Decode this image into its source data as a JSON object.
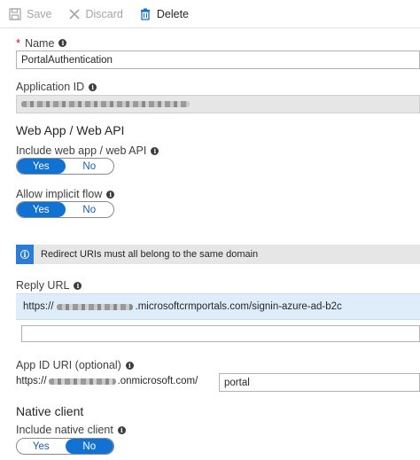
{
  "toolbar": {
    "save_label": "Save",
    "discard_label": "Discard",
    "delete_label": "Delete"
  },
  "name": {
    "required_marker": "*",
    "label": "Name",
    "value": "PortalAuthentication"
  },
  "application_id": {
    "label": "Application ID"
  },
  "web_app": {
    "heading": "Web App / Web API",
    "include_label": "Include web app / web API",
    "include_yes": "Yes",
    "include_no": "No",
    "include_selected": "Yes",
    "implicit_label": "Allow implicit flow",
    "implicit_yes": "Yes",
    "implicit_no": "No",
    "implicit_selected": "Yes"
  },
  "banner": {
    "icon": "info-icon",
    "text": "Redirect URIs must all belong to the same domain"
  },
  "reply_url": {
    "label": "Reply URL",
    "prefix": "https://",
    "suffix": ".microsoftcrmportals.com/signin-azure-ad-b2c",
    "new_value": ""
  },
  "app_id_uri": {
    "label": "App ID URI (optional)",
    "prefix": "https://",
    "domain_suffix": ".onmicrosoft.com/",
    "value": "portal"
  },
  "native": {
    "heading": "Native client",
    "include_label": "Include native client",
    "yes": "Yes",
    "no": "No",
    "selected": "No"
  },
  "colors": {
    "accent": "#1272d3",
    "required": "#e00b1c",
    "banner_bg": "#e6e6e6",
    "selected_row": "#deedf9"
  }
}
